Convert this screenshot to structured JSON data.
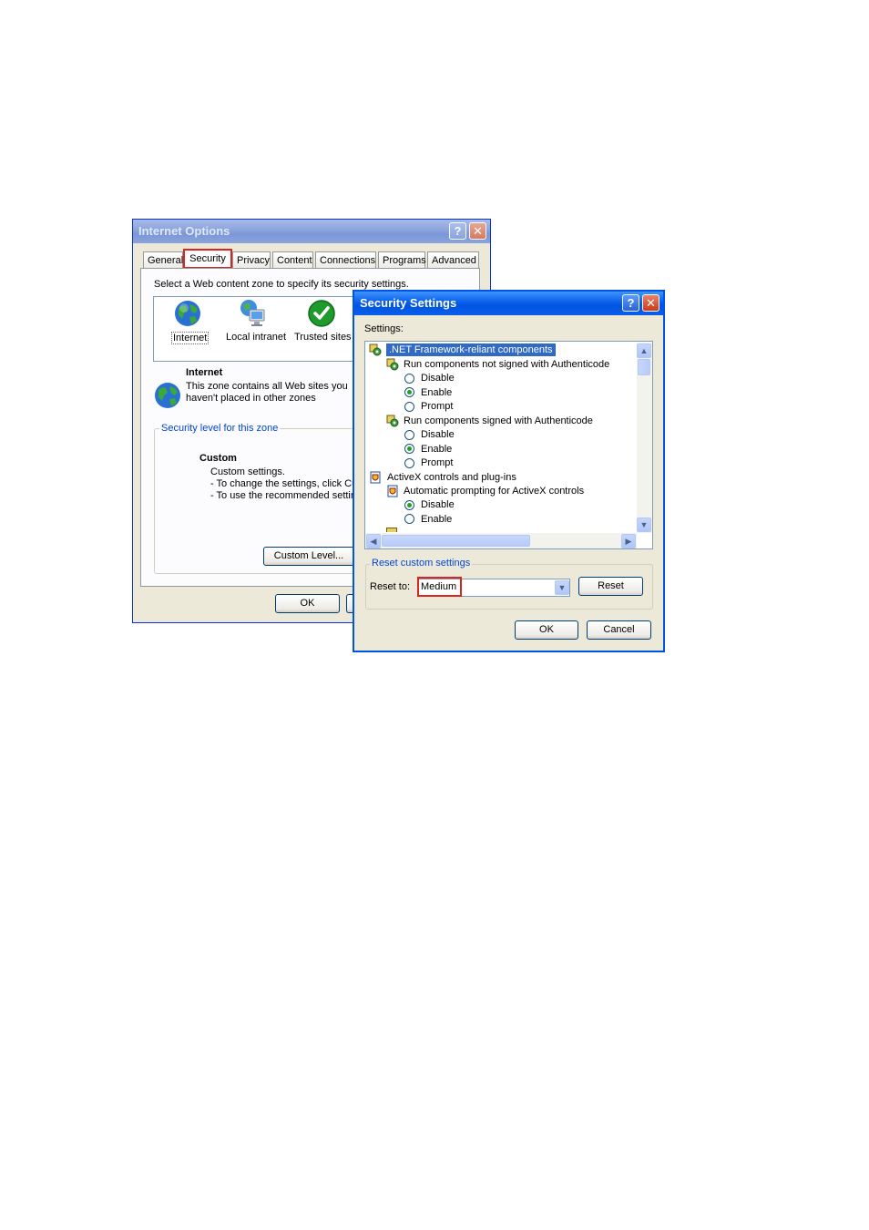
{
  "internet_options": {
    "title": "Internet Options",
    "tabs": [
      {
        "label": "General"
      },
      {
        "label": "Security"
      },
      {
        "label": "Privacy"
      },
      {
        "label": "Content"
      },
      {
        "label": "Connections"
      },
      {
        "label": "Programs"
      },
      {
        "label": "Advanced"
      }
    ],
    "active_tab": "Security",
    "instruction": "Select a Web content zone to specify its security settings.",
    "zones": [
      {
        "label": "Internet",
        "icon": "globe-icon"
      },
      {
        "label": "Local intranet",
        "icon": "intranet-icon"
      },
      {
        "label": "Trusted sites",
        "icon": "checkmark-icon"
      }
    ],
    "zone_info": {
      "title": "Internet",
      "line1": "This zone contains all Web sites you",
      "line2": "haven't placed in other zones"
    },
    "security_level": {
      "group_title": "Security level for this zone",
      "level": "Custom",
      "line1": "Custom settings.",
      "line2": "- To change the settings, click Cus",
      "line3": "- To use the recommended setting"
    },
    "custom_level_button": "Custom Level...",
    "ok_button": "OK"
  },
  "security_settings": {
    "title": "Security Settings",
    "settings_label": "Settings:",
    "tree": [
      {
        "text": ".NET Framework-reliant components",
        "kind": "category",
        "selected": true
      },
      {
        "text": "Run components not signed with Authenticode",
        "kind": "setting"
      },
      {
        "text": "Disable",
        "kind": "option",
        "checked": false
      },
      {
        "text": "Enable",
        "kind": "option",
        "checked": true
      },
      {
        "text": "Prompt",
        "kind": "option",
        "checked": false
      },
      {
        "text": "Run components signed with Authenticode",
        "kind": "setting"
      },
      {
        "text": "Disable",
        "kind": "option",
        "checked": false
      },
      {
        "text": "Enable",
        "kind": "option",
        "checked": true
      },
      {
        "text": "Prompt",
        "kind": "option",
        "checked": false
      },
      {
        "text": "ActiveX controls and plug-ins",
        "kind": "category"
      },
      {
        "text": "Automatic prompting for ActiveX controls",
        "kind": "setting"
      },
      {
        "text": "Disable",
        "kind": "option",
        "checked": true
      },
      {
        "text": "Enable",
        "kind": "option",
        "checked": false
      }
    ],
    "reset_group_title": "Reset custom settings",
    "reset_to_label": "Reset to:",
    "reset_to_value": "Medium",
    "reset_button": "Reset",
    "ok_button": "OK",
    "cancel_button": "Cancel"
  },
  "colors": {
    "highlight": "#d9251d",
    "selection": "#316ac5",
    "title_active": "#0054e3",
    "title_inactive": "#7b97d6"
  }
}
